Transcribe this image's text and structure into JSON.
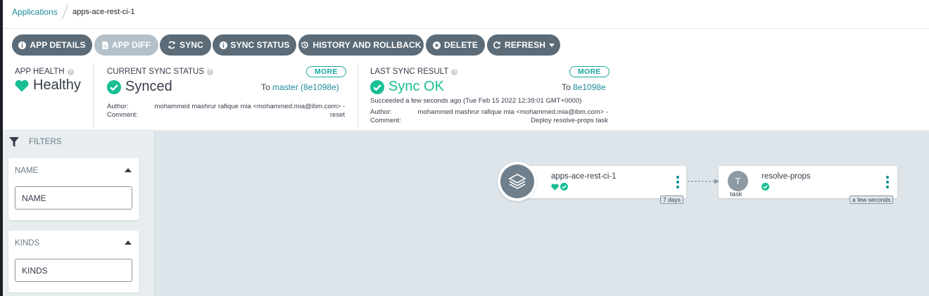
{
  "breadcrumb": {
    "root": "Applications",
    "current": "apps-ace-rest-ci-1"
  },
  "toolbar": {
    "app_details": "APP DETAILS",
    "app_diff": "APP DIFF",
    "sync": "SYNC",
    "sync_status": "SYNC STATUS",
    "history": "HISTORY AND ROLLBACK",
    "delete": "DELETE",
    "refresh": "REFRESH"
  },
  "health": {
    "label": "APP HEALTH",
    "value": "Healthy"
  },
  "sync_status": {
    "label": "CURRENT SYNC STATUS",
    "value": "Synced",
    "more": "MORE",
    "to_prefix": "To",
    "to_target": "master (8e1098e)",
    "author_label": "Author:",
    "author": "mohammed mashrur rafique mia <mohammed.mia@ibm.com> -",
    "comment_label": "Comment:",
    "comment": "reset"
  },
  "last_sync": {
    "label": "LAST SYNC RESULT",
    "value": "Sync OK",
    "more": "MORE",
    "to_prefix": "To",
    "to_target": "8e1098e",
    "succeeded": "Succeeded a few seconds ago (Tue Feb 15 2022 12:39:01 GMT+0000)",
    "author_label": "Author:",
    "author": "mohammed mashrur rafique mia <mohammed.mia@ibm.com> -",
    "comment_label": "Comment:",
    "comment": "Deploy resolve-props task"
  },
  "filters": {
    "title": "FILTERS",
    "name": {
      "title": "NAME",
      "placeholder": "NAME"
    },
    "kinds": {
      "title": "KINDS",
      "placeholder": "KINDS"
    }
  },
  "graph": {
    "app_node": {
      "name": "apps-ace-rest-ci-1",
      "age": "7 days",
      "icon": "layers-icon"
    },
    "task_node": {
      "name": "resolve-props",
      "letter": "T",
      "kind": "task",
      "age": "a few seconds"
    }
  },
  "colors": {
    "accent": "#18be94",
    "toolbar": "#5b6b77",
    "link": "#1b8a9a"
  }
}
